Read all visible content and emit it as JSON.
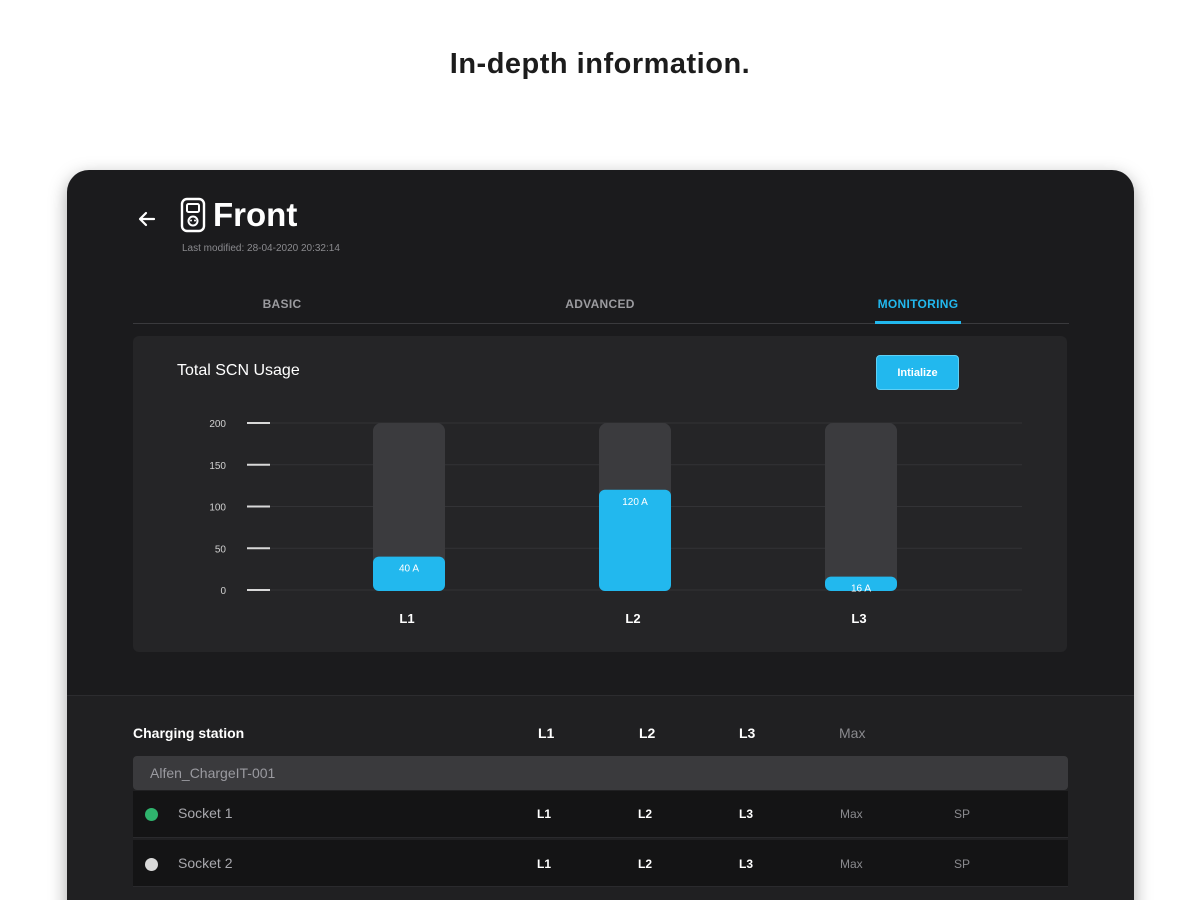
{
  "headline": "In-depth information.",
  "header": {
    "back_icon": "arrow-left-icon",
    "station_icon": "charger-icon",
    "title": "Front",
    "last_modified": "Last modified: 28-04-2020 20:32:14"
  },
  "tabs": [
    {
      "label": "BASIC",
      "active": false
    },
    {
      "label": "ADVANCED",
      "active": false
    },
    {
      "label": "MONITORING",
      "active": true
    }
  ],
  "chart_card": {
    "title": "Total SCN Usage",
    "initialize_label": "Intialize"
  },
  "chart_data": {
    "type": "bar",
    "title": "Total SCN Usage",
    "categories": [
      "L1",
      "L2",
      "L3"
    ],
    "values": [
      40,
      120,
      16
    ],
    "data_labels": [
      "40 A",
      "120 A",
      "16 A"
    ],
    "y_ticks": [
      "0",
      "50",
      "100",
      "150",
      "200"
    ],
    "ylim": [
      0,
      200
    ],
    "grid": true,
    "colors": {
      "fill": "#22b8ee",
      "track": "#3b3b3e"
    }
  },
  "table": {
    "headers": {
      "station": "Charging station",
      "l1": "L1",
      "l2": "L2",
      "l3": "L3",
      "max": "Max"
    },
    "station_name": "Alfen_ChargeIT-001",
    "sockets": [
      {
        "name": "Socket 1",
        "status_color": "#2fb36d",
        "l1": "L1",
        "l2": "L2",
        "l3": "L3",
        "max": "Max",
        "sp": "SP"
      },
      {
        "name": "Socket 2",
        "status_color": "#d9d9d9",
        "l1": "L1",
        "l2": "L2",
        "l3": "L3",
        "max": "Max",
        "sp": "SP"
      }
    ]
  }
}
